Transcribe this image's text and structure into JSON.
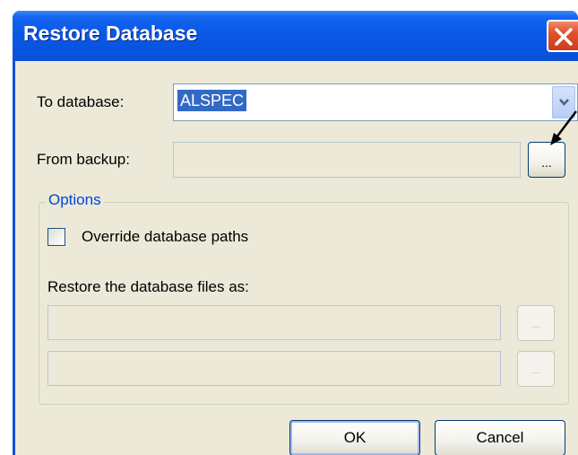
{
  "window": {
    "title": "Restore Database"
  },
  "form": {
    "to_database_label": "To database:",
    "to_database_value": "ALSPEC",
    "from_backup_label": "From backup:",
    "from_backup_value": "",
    "browse_label": "...",
    "options_group_title": "Options",
    "override_paths_label": "Override database paths",
    "override_paths_checked": false,
    "restore_files_label": "Restore the database files as:",
    "restore_file_1": "",
    "restore_file_2": "",
    "browse_file_1_label": "...",
    "browse_file_2_label": "..."
  },
  "buttons": {
    "ok_label": "OK",
    "cancel_label": "Cancel"
  },
  "colors": {
    "titlebar": "#0a58e6",
    "dialog_bg": "#ece9d8",
    "selection": "#316ac5",
    "group_title": "#0046d5",
    "close_button": "#e0512a"
  },
  "icons": {
    "close": "close-icon",
    "dropdown": "chevron-down-icon",
    "annotation": "annotation-arrow-icon"
  }
}
